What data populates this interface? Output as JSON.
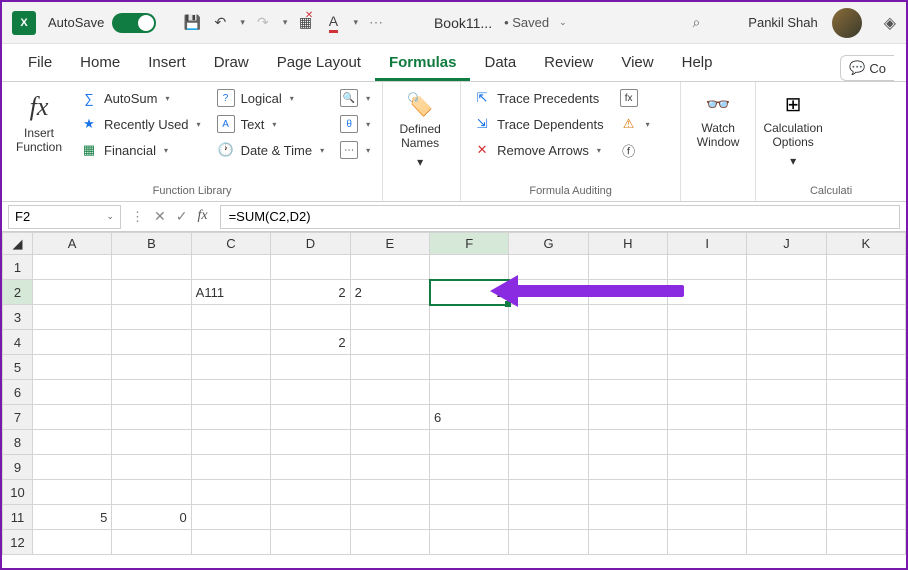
{
  "titlebar": {
    "autosave": "AutoSave",
    "docname": "Book11...",
    "saved": "• Saved",
    "user": "Pankil Shah"
  },
  "tabs": {
    "file": "File",
    "home": "Home",
    "insert": "Insert",
    "draw": "Draw",
    "pagelayout": "Page Layout",
    "formulas": "Formulas",
    "data": "Data",
    "review": "Review",
    "view": "View",
    "help": "Help",
    "comments": "Co"
  },
  "ribbon": {
    "insertfn": "Insert Function",
    "autosum": "AutoSum",
    "recent": "Recently Used",
    "financial": "Financial",
    "logical": "Logical",
    "text": "Text",
    "datetime": "Date & Time",
    "defined": "Defined Names",
    "traceprec": "Trace Precedents",
    "tracedep": "Trace Dependents",
    "removearr": "Remove Arrows",
    "watch": "Watch Window",
    "calcopt": "Calculation Options",
    "grp_lib": "Function Library",
    "grp_audit": "Formula Auditing",
    "grp_calc": "Calculati"
  },
  "formulabar": {
    "cellref": "F2",
    "formula": "=SUM(C2,D2)"
  },
  "cols": [
    "A",
    "B",
    "C",
    "D",
    "E",
    "F",
    "G",
    "H",
    "I",
    "J",
    "K"
  ],
  "rows": [
    "1",
    "2",
    "3",
    "4",
    "5",
    "6",
    "7",
    "8",
    "9",
    "10",
    "11",
    "12"
  ],
  "cells": {
    "C2": "A111",
    "D2": "2",
    "E2": "2",
    "F2": "2",
    "D4": "2",
    "F7": "6",
    "A11": "5",
    "B11": "0"
  }
}
